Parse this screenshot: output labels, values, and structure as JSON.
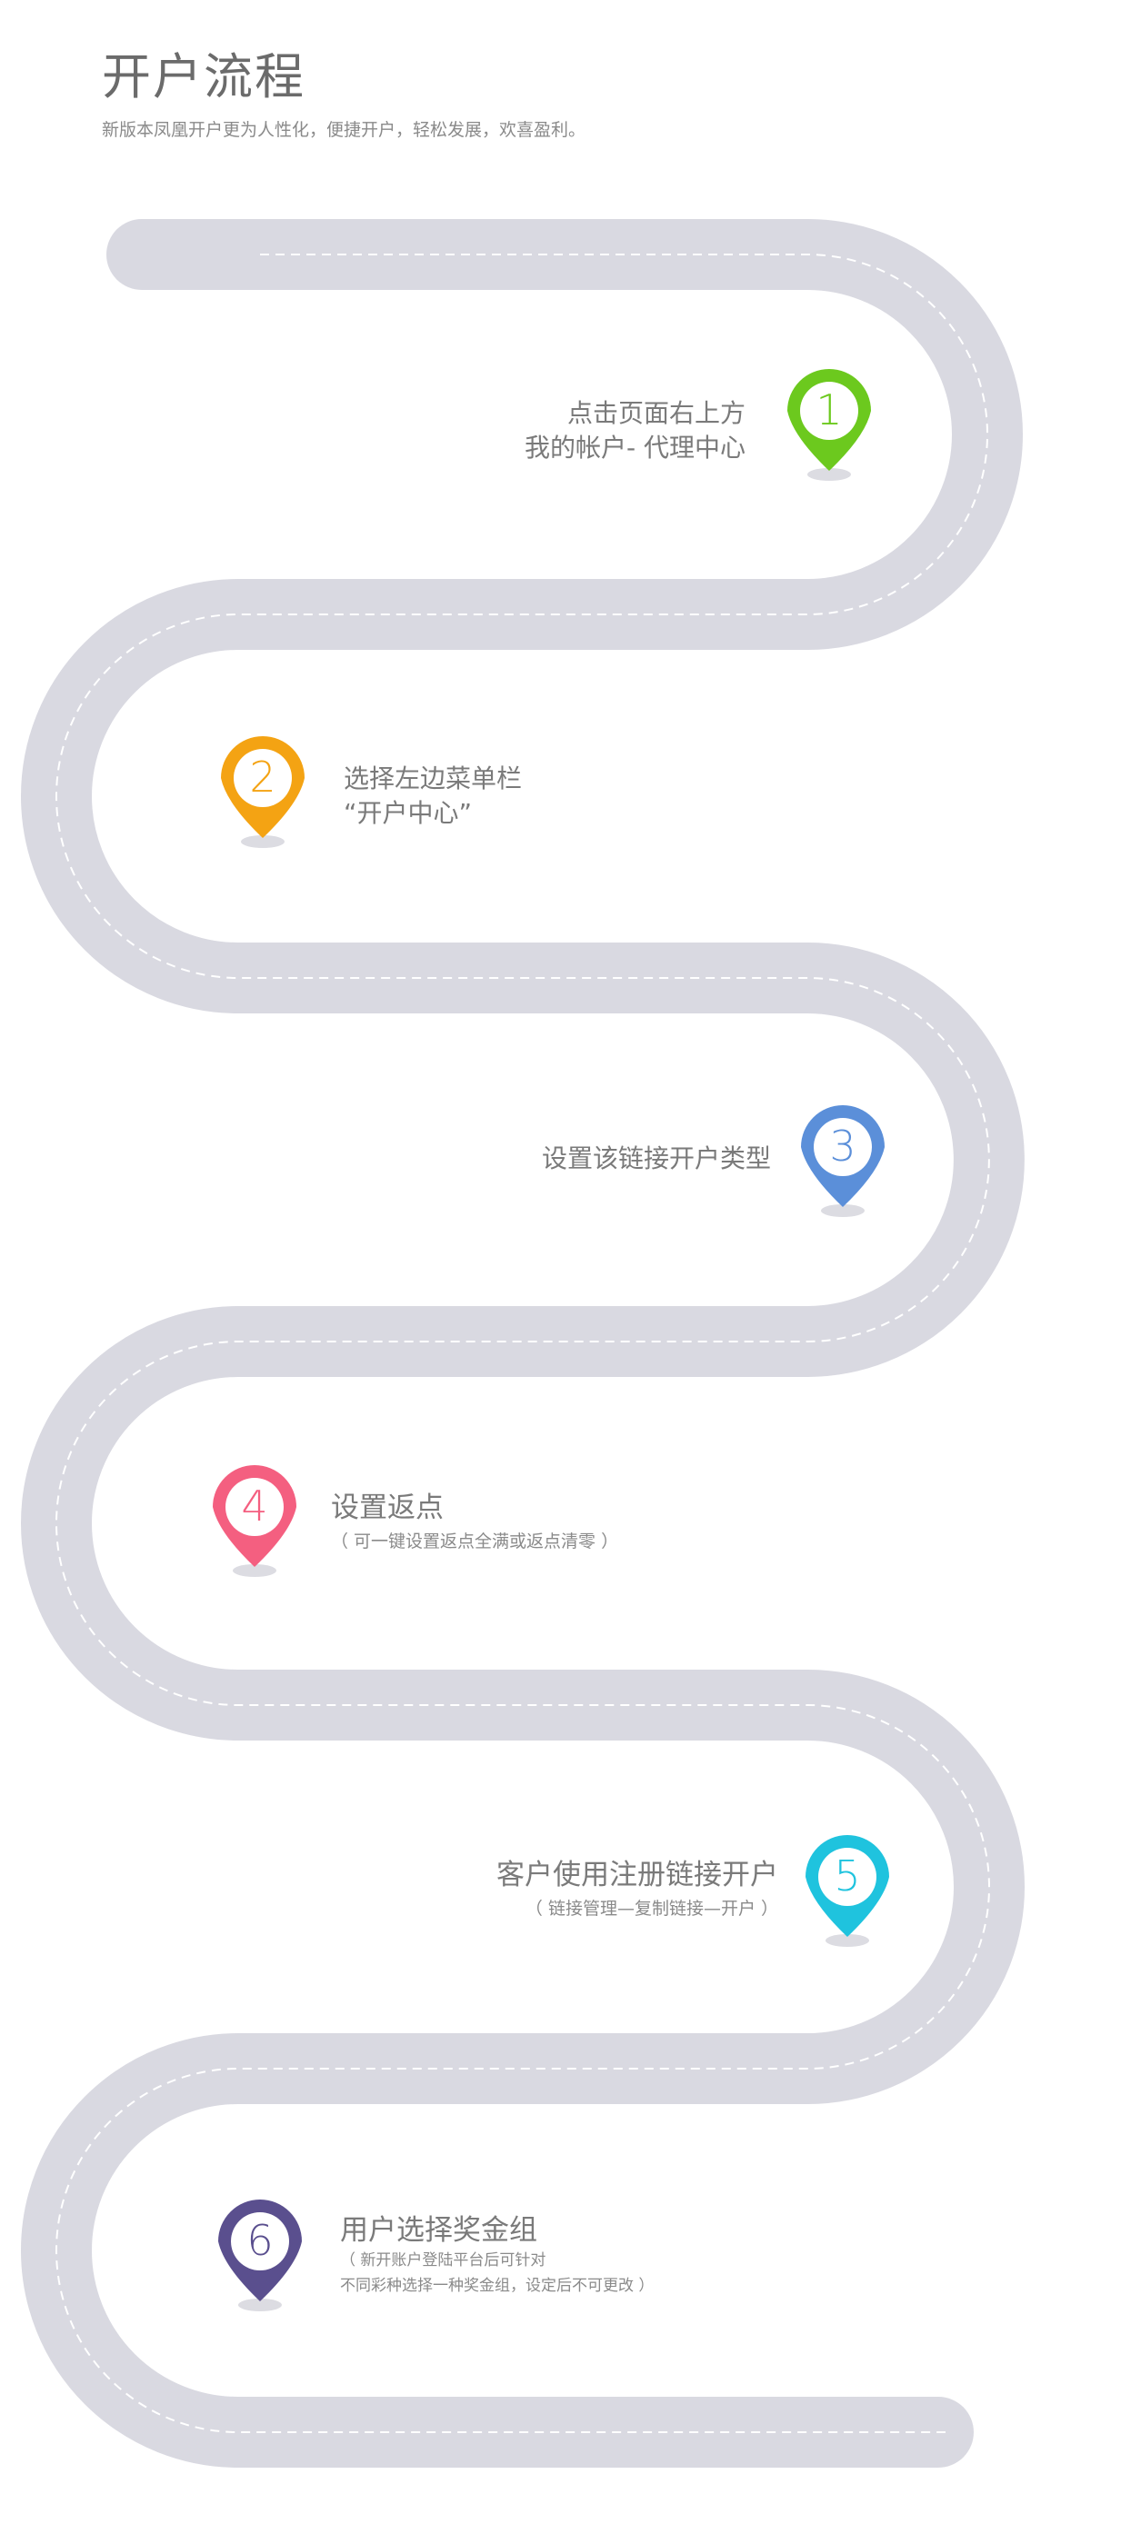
{
  "header": {
    "title": "开户流程",
    "subtitle": "新版本凤凰开户更为人性化，便捷开户，轻松发展，欢喜盈利。"
  },
  "colors": {
    "road": "#d9d9e1",
    "dash": "#ffffff",
    "step1": "#6cc91e",
    "step2": "#f4a313",
    "step3": "#5b8fd9",
    "step4": "#f45f80",
    "step5": "#1fc3de",
    "step6": "#5a4f8e",
    "shadow": "#dcdce2"
  },
  "steps": [
    {
      "number": "1",
      "line1": "点击页面右上方",
      "line2": "我的帐户- 代理中心",
      "icon": "map-pin-icon"
    },
    {
      "number": "2",
      "line1": "选择左边菜单栏",
      "line2": "“开户中心”",
      "icon": "map-pin-icon"
    },
    {
      "number": "3",
      "line1": "设置该链接开户类型",
      "icon": "map-pin-icon"
    },
    {
      "number": "4",
      "line1": "设置返点",
      "note1": "（ 可一键设置返点全满或返点清零 ）",
      "icon": "map-pin-icon"
    },
    {
      "number": "5",
      "line1": "客户使用注册链接开户",
      "note1": "（ 链接管理—复制链接—开户 ）",
      "icon": "map-pin-icon"
    },
    {
      "number": "6",
      "line1": "用户选择奖金组",
      "note1": "（ 新开账户登陆平台后可针对",
      "note2": "不同彩种选择一种奖金组，设定后不可更改 ）",
      "icon": "map-pin-icon"
    }
  ]
}
